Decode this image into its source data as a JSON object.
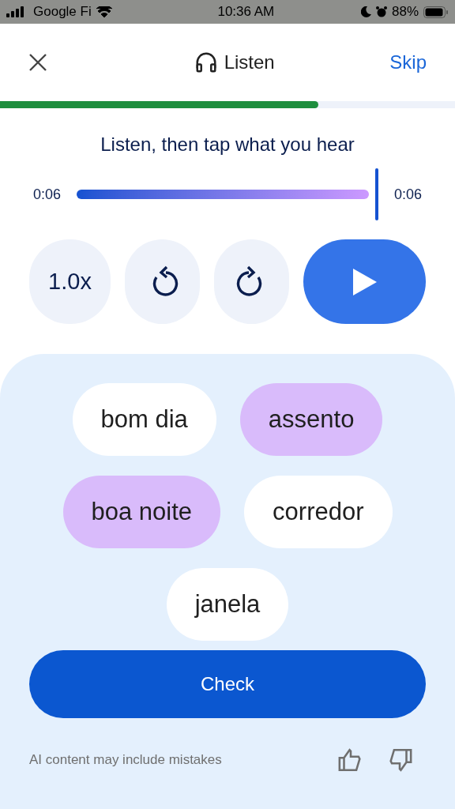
{
  "status_bar": {
    "carrier": "Google Fi",
    "time": "10:36 AM",
    "battery": "88%"
  },
  "header": {
    "title": "Listen",
    "skip": "Skip"
  },
  "progress": {
    "level": 0.7
  },
  "prompt": "Listen, then tap what you hear",
  "player": {
    "elapsed": "0:06",
    "duration": "0:06",
    "level": 1,
    "speed": "1.0x"
  },
  "word_rows": [
    [
      {
        "label": "bom dia",
        "selected": false
      },
      {
        "label": "assento",
        "selected": true
      }
    ],
    [
      {
        "label": "boa noite",
        "selected": true
      },
      {
        "label": "corredor",
        "selected": false
      }
    ],
    [
      {
        "label": "janela",
        "selected": false
      }
    ]
  ],
  "check_button": "Check",
  "footer": "AI content may include mistakes"
}
